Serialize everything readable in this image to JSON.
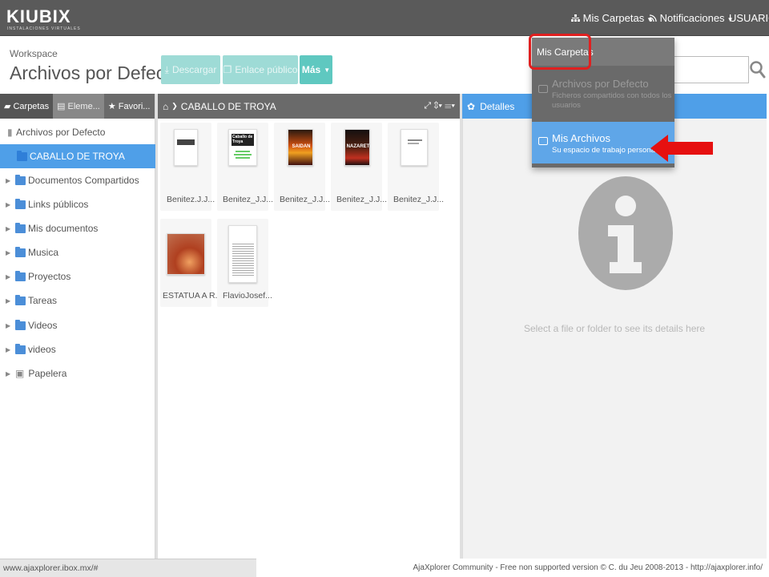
{
  "app": {
    "logo": "KIUBIX",
    "logo_sub": "INSTALACIONES VIRTUALES"
  },
  "topbar": {
    "my_folders": "Mis Carpetas",
    "notifications": "Notificaciones",
    "user": "USUARIO"
  },
  "header": {
    "workspace_label": "Workspace",
    "title": "Archivos por Defecto",
    "download": "Descargar",
    "public_link": "Enlace público",
    "more": "Más"
  },
  "left_tabs": {
    "folders": "Carpetas",
    "elements": "Eleme...",
    "favorites": "Favori..."
  },
  "tree": [
    {
      "label": "Archivos por Defecto"
    },
    {
      "label": "CABALLO DE TROYA"
    },
    {
      "label": "Documentos Compartidos"
    },
    {
      "label": "Links públicos"
    },
    {
      "label": "Mis documentos"
    },
    {
      "label": "Musica"
    },
    {
      "label": "Proyectos"
    },
    {
      "label": "Tareas"
    },
    {
      "label": "Videos"
    },
    {
      "label": "videos"
    },
    {
      "label": "Papelera"
    }
  ],
  "center": {
    "breadcrumb": "CABALLO DE TROYA",
    "files": [
      {
        "name": "Benitez.J.J..."
      },
      {
        "name": "Benitez_J.J..."
      },
      {
        "name": "Benitez_J.J..."
      },
      {
        "name": "Benitez_J.J..."
      },
      {
        "name": "Benitez_J.J..."
      },
      {
        "name": "ESTATUA A R..."
      },
      {
        "name": "FlavioJosef..."
      }
    ],
    "thumb_text": {
      "cover_title": "Caballo de Troya",
      "book1": "SAIDAN",
      "book2": "NAZARET"
    }
  },
  "details": {
    "title": "Detalles",
    "empty_message": "Select a file or folder to see its details here"
  },
  "dropdown": {
    "header": "Mis Carpetas",
    "items": [
      {
        "title": "Archivos por Defecto",
        "subtitle": "Ficheros compartidos con todos los usuarios"
      },
      {
        "title": "Mis Archivos",
        "subtitle": "Su espacio de trabajo personal"
      }
    ]
  },
  "footer": {
    "status_url": "www.ajaxplorer.ibox.mx/#",
    "note": "AjaXplorer Community - Free non supported version © C. du Jeu 2008-2013 - http://ajaxplorer.info/"
  },
  "colors": {
    "topbar": "#5a5a5a",
    "accent_blue": "#4f9fe8",
    "teal_button": "#5fc8c0",
    "highlight_red": "#e02020"
  }
}
